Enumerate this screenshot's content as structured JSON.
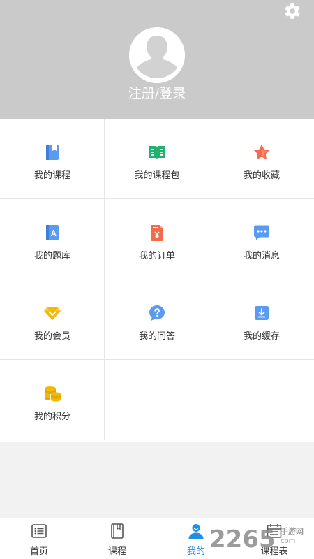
{
  "header": {
    "login_label": "注册/登录",
    "settings_icon": "gear-icon",
    "avatar_icon": "default-avatar-icon"
  },
  "menu": [
    {
      "label": "我的课程",
      "icon": "book-icon",
      "color": "#5b9bef"
    },
    {
      "label": "我的课程包",
      "icon": "open-book-icon",
      "color": "#1fb36b"
    },
    {
      "label": "我的收藏",
      "icon": "star-icon",
      "color": "#f56b4e"
    },
    {
      "label": "我的题库",
      "icon": "question-bank-icon",
      "color": "#5b9bef"
    },
    {
      "label": "我的订单",
      "icon": "order-document-icon",
      "color": "#f36b4a"
    },
    {
      "label": "我的消息",
      "icon": "message-bubble-icon",
      "color": "#5b9bef"
    },
    {
      "label": "我的会员",
      "icon": "vip-badge-icon",
      "color": "#f5b800"
    },
    {
      "label": "我的问答",
      "icon": "question-bubble-icon",
      "color": "#5b9bef"
    },
    {
      "label": "我的缓存",
      "icon": "download-icon",
      "color": "#5b9bef"
    },
    {
      "label": "我的积分",
      "icon": "coin-stack-icon",
      "color": "#f5b800"
    }
  ],
  "tabs": [
    {
      "label": "首页",
      "icon": "list-icon",
      "active": false
    },
    {
      "label": "课程",
      "icon": "course-book-icon",
      "active": false
    },
    {
      "label": "我的",
      "icon": "person-icon",
      "active": true
    },
    {
      "label": "课程表",
      "icon": "calendar-icon",
      "active": false
    }
  ],
  "watermark": {
    "number": "2265",
    "brand": "手游网",
    "domain": "com"
  },
  "colors": {
    "header_bg": "#cacaca",
    "accent": "#1f8fe6"
  }
}
